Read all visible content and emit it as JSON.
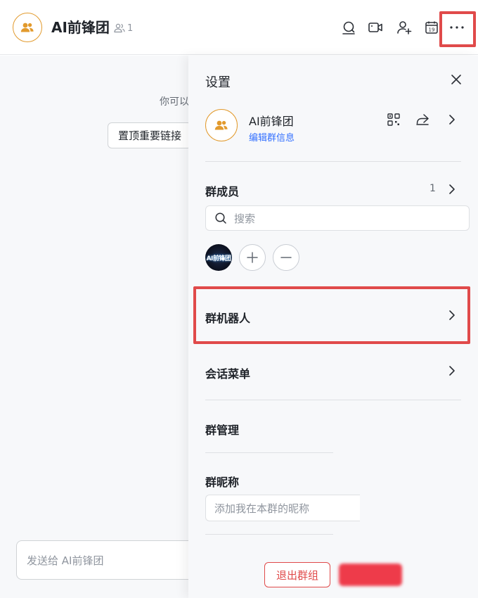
{
  "header": {
    "title": "AI前锋团",
    "member_count": "1",
    "icons": [
      "search-chat-icon",
      "video-call-icon",
      "add-member-icon",
      "calendar-icon",
      "more-icon"
    ],
    "calendar_day": "19",
    "more_label": "···"
  },
  "chat": {
    "hint": "你可以",
    "pin_label": "置顶重要链接",
    "composer_placeholder": "发送给 AI前锋团"
  },
  "settings": {
    "title": "设置",
    "group_name": "AI前锋团",
    "edit_link": "编辑群信息",
    "members": {
      "label": "群成员",
      "count": "1",
      "search_placeholder": "搜索",
      "member_avatar_text": "AI前锋团"
    },
    "rows": {
      "bots": "群机器人",
      "session_menu": "会话菜单",
      "group_admin": "群管理",
      "nickname": "群昵称"
    },
    "nickname_placeholder": "添加我在本群的昵称",
    "leave_label": "退出群组"
  },
  "colors": {
    "accent_orange": "#e29a2d",
    "link_blue": "#3370ff",
    "danger_red": "#e04a4a",
    "highlight_red": "#e04a4a"
  }
}
